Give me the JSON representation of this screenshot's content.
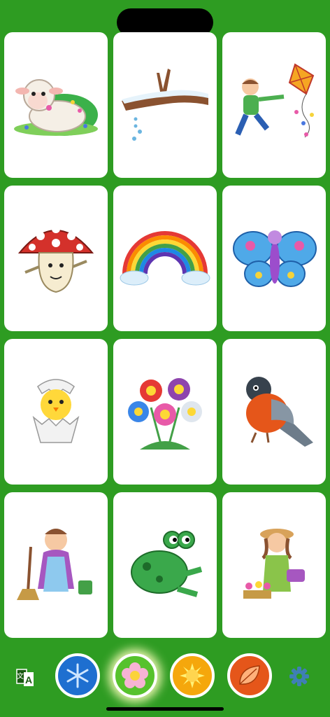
{
  "cards": [
    {
      "name": "lamb-card",
      "icon": "lamb-picture"
    },
    {
      "name": "snowy-branch-card",
      "icon": "snowy-branch-picture"
    },
    {
      "name": "boy-kite-card",
      "icon": "boy-with-kite-picture"
    },
    {
      "name": "mushroom-card",
      "icon": "mushroom-character-picture"
    },
    {
      "name": "rainbow-card",
      "icon": "rainbow-picture"
    },
    {
      "name": "butterfly-card",
      "icon": "butterfly-picture"
    },
    {
      "name": "chick-card",
      "icon": "hatching-chick-picture"
    },
    {
      "name": "flowers-card",
      "icon": "flowers-picture"
    },
    {
      "name": "bullfinch-card",
      "icon": "bullfinch-bird-picture"
    },
    {
      "name": "grandma-broom-card",
      "icon": "grandma-with-broom-picture"
    },
    {
      "name": "frog-card",
      "icon": "frog-picture"
    },
    {
      "name": "gardener-girl-card",
      "icon": "girl-gardener-picture"
    }
  ],
  "toolbar": {
    "language_icon": "translate-icon",
    "seasons": [
      {
        "name": "winter",
        "icon": "snowflake-icon",
        "color": "#1e6fd0",
        "active": false
      },
      {
        "name": "spring",
        "icon": "flower-icon",
        "color": "#56c22c",
        "active": true
      },
      {
        "name": "summer",
        "icon": "sun-icon",
        "color": "#f5a70c",
        "active": false
      },
      {
        "name": "autumn",
        "icon": "leaf-icon",
        "color": "#e5561a",
        "active": false
      }
    ],
    "settings_icon": "gear-icon"
  },
  "colors": {
    "background": "#2e9c22",
    "card": "#ffffff"
  }
}
